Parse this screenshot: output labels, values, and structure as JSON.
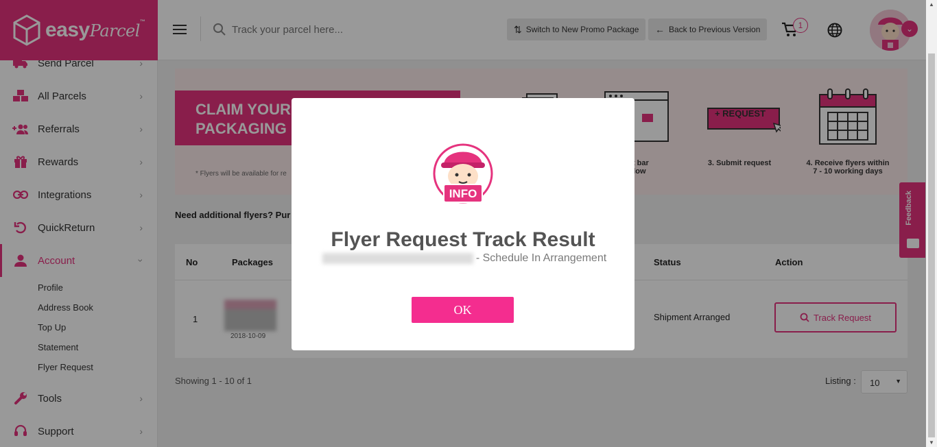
{
  "brand": {
    "name": "easy",
    "script": "Parcel",
    "tm": "™",
    "color": "#e5337e"
  },
  "sidebar": {
    "items": [
      {
        "label": "Send Parcel",
        "icon": "truck-icon"
      },
      {
        "label": "All Parcels",
        "icon": "boxes-icon"
      },
      {
        "label": "Referrals",
        "icon": "add-users-icon"
      },
      {
        "label": "Rewards",
        "icon": "gift-icon"
      },
      {
        "label": "Integrations",
        "icon": "link-icon"
      },
      {
        "label": "QuickReturn",
        "icon": "return-icon"
      },
      {
        "label": "Account",
        "icon": "user-icon",
        "active": true
      },
      {
        "label": "Tools",
        "icon": "wrench-icon"
      },
      {
        "label": "Support",
        "icon": "headset-icon"
      }
    ],
    "account_sub": [
      "Profile",
      "Address Book",
      "Top Up",
      "Statement",
      "Flyer Request"
    ]
  },
  "header": {
    "search_placeholder": "Track your parcel here...",
    "switch_label": "Switch to New Promo Package",
    "back_label": "Back to Previous Version",
    "cart_count": "1"
  },
  "banner": {
    "headline_1": "CLAIM YOUR",
    "headline_2": "PACKAGING",
    "note": "* Flyers will be available for re",
    "step2": "uest bar",
    "step2b": "r below",
    "step3": "3. Submit request",
    "step4a": "4. Receive flyers within",
    "step4b": "7 - 10 working days",
    "request_btn": "+ REQUEST"
  },
  "need_text": "Need additional flyers? Pur",
  "table": {
    "headers": {
      "no": "No",
      "packages": "Packages",
      "status": "Status",
      "action": "Action"
    },
    "rows": [
      {
        "no": "1",
        "date": "2018-10-09",
        "status": "Shipment Arranged",
        "action": "Track Request"
      }
    ]
  },
  "pagination": {
    "showing": "Showing 1 - 10 of 1",
    "listing_label": "Listing :",
    "listing_value": "10"
  },
  "feedback": "Feedback",
  "modal": {
    "badge": "INFO",
    "title": "Flyer Request Track Result",
    "subtitle": "- Schedule In Arrangement",
    "ok": "OK"
  }
}
